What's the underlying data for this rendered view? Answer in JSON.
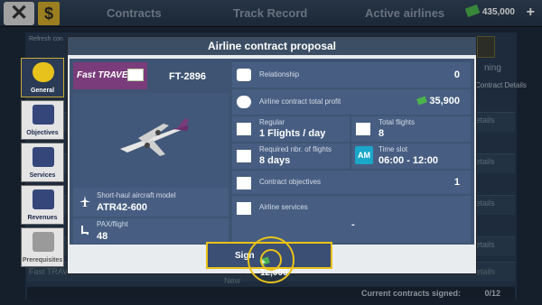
{
  "topbar": {
    "tabs": [
      "Contracts",
      "Track Record",
      "Active airlines"
    ],
    "money": "435,000"
  },
  "background": {
    "refresh_label": "Refresh con",
    "right_label": "ning",
    "details_label": "Contract Details",
    "details_short": "etails",
    "footer_label": "Current contracts signed:",
    "footer_value": "0/12",
    "row_left": "Fast TRAVEL",
    "row_new": "New"
  },
  "modal": {
    "title": "Airline contract proposal",
    "airline_name": "Fast TRAVEL",
    "flight_code": "FT-2896",
    "aircraft_label": "Short-haul aircraft model",
    "aircraft_value": "ATR42-600",
    "pax_label": "PAX/flight",
    "pax_value": "48",
    "relationship_label": "Relationship",
    "relationship_value": "0",
    "profit_label": "Airline contract total profit",
    "profit_value": "35,900",
    "regular_label": "Regular",
    "regular_value": "1 Flights / day",
    "total_flights_label": "Total flights",
    "total_flights_value": "8",
    "required_label": "Required nbr. of flights",
    "required_value": "8 days",
    "time_slot_label": "Time slot",
    "time_slot_badge": "AM",
    "time_slot_value": "06:00 - 12:00",
    "objectives_label": "Contract objectives",
    "objectives_value": "1",
    "services_label": "Airline services",
    "services_value": "-",
    "sign_label": "Sign",
    "sign_cost": "+ 12,000"
  },
  "side_tabs": [
    "General",
    "Objectives",
    "Services",
    "Revenues",
    "Prerequisites"
  ],
  "colors": {
    "accent": "#e9c219",
    "panel": "#3e5472",
    "cash": "#4bb34e"
  }
}
